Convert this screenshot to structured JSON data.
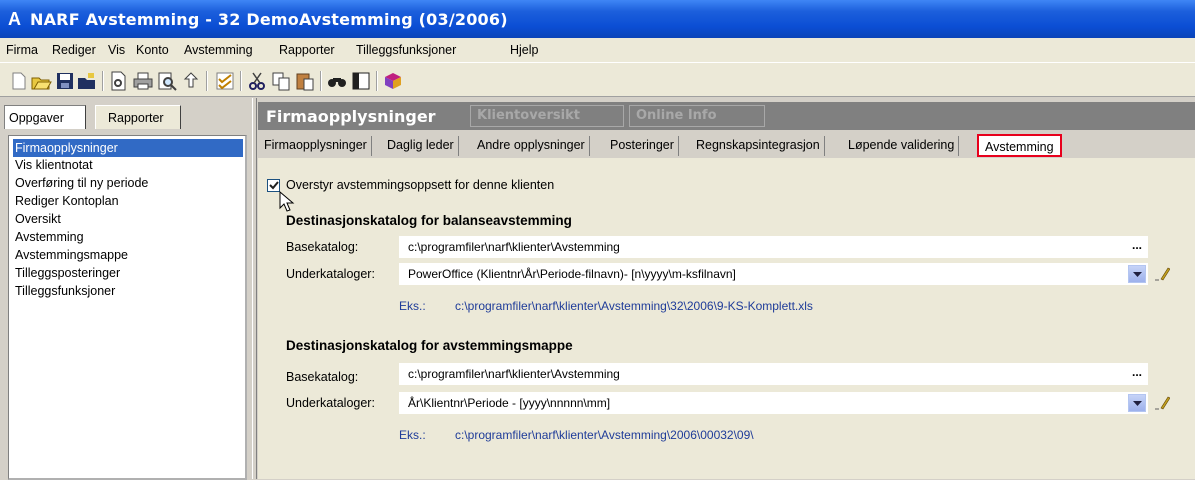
{
  "window": {
    "title": "NARF Avstemming - 32 DemoAvstemming (03/2006)",
    "app_icon": "A"
  },
  "menu": [
    "Firma",
    "Rediger",
    "Vis",
    "Konto",
    "Avstemming",
    "Rapporter",
    "Tilleggsfunksjoner",
    "Hjelp"
  ],
  "toolbar": {
    "icons": [
      "new-icon",
      "open-icon",
      "save-icon",
      "open-folder-icon",
      "print-preview-icon",
      "print-icon",
      "preview-icon",
      "export-icon",
      "check-icon",
      "cut-icon",
      "copy-icon",
      "paste-icon",
      "find-icon",
      "view-icon",
      "help-book-icon"
    ]
  },
  "left": {
    "tabs": [
      "Oppgaver",
      "Rapporter"
    ],
    "tasks": [
      "Firmaopplysninger",
      "Vis klientnotat",
      "Overføring til ny periode",
      "Rediger Kontoplan",
      "Oversikt",
      "Avstemming",
      "Avstemmingsmappe",
      "Tilleggsposteringer",
      "Tilleggsfunksjoner"
    ],
    "selected": "Firmaopplysninger"
  },
  "right": {
    "header_title": "Firmaopplysninger",
    "header_tabs": [
      "Klientoversikt",
      "Online Info"
    ],
    "subtabs": [
      "Firmaopplysninger",
      "Daglig leder",
      "Andre opplysninger",
      "Posteringer",
      "Regnskapsintegrasjon",
      "Løpende validering",
      "Avstemming"
    ],
    "active_subtab": "Avstemming"
  },
  "form": {
    "override_label": "Overstyr avstemmingsoppsett for denne klienten",
    "override_checked": true,
    "section1": {
      "title": "Destinasjonskatalog for balanseavstemming",
      "base_label": "Basekatalog:",
      "base_value": "c:\\programfiler\\narf\\klienter\\Avstemming",
      "sub_label": "Underkataloger:",
      "sub_value": "PowerOffice (Klientnr\\År\\Periode-filnavn)- [n\\yyyy\\m-ksfilnavn]",
      "example_label": "Eks.:",
      "example_value": "c:\\programfiler\\narf\\klienter\\Avstemming\\32\\2006\\9-KS-Komplett.xls"
    },
    "section2": {
      "title": "Destinasjonskatalog for avstemmingsmappe",
      "base_label": "Basekatalog:",
      "base_value": "c:\\programfiler\\narf\\klienter\\Avstemming",
      "sub_label": "Underkataloger:",
      "sub_value": "År\\Klientnr\\Periode - [yyyy\\nnnnn\\mm]",
      "example_label": "Eks.:",
      "example_value": "c:\\programfiler\\narf\\klienter\\Avstemming\\2006\\00032\\09\\"
    },
    "ellipsis": "...",
    "highlight_color": "#e8001c",
    "selection_color": "#316ac5"
  }
}
